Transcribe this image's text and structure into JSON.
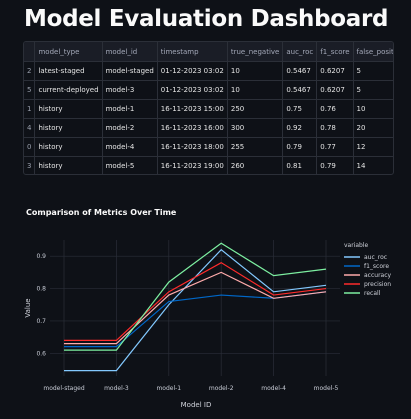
{
  "page": {
    "title": "Model Evaluation Dashboard"
  },
  "table": {
    "columns": [
      "",
      "model_type",
      "model_id",
      "timestamp",
      "true_negative",
      "auc_roc",
      "f1_score",
      "false_positive"
    ],
    "rows": [
      [
        "2",
        "latest-staged",
        "model-staged",
        "01-12-2023 03:02",
        "10",
        "0.5467",
        "0.6207",
        "5"
      ],
      [
        "5",
        "current-deployed",
        "model-3",
        "01-12-2023 03:02",
        "10",
        "0.5467",
        "0.6207",
        "5"
      ],
      [
        "1",
        "history",
        "model-1",
        "16-11-2023 15:00",
        "250",
        "0.75",
        "0.76",
        "10"
      ],
      [
        "4",
        "history",
        "model-2",
        "16-11-2023 16:00",
        "300",
        "0.92",
        "0.78",
        "20"
      ],
      [
        "0",
        "history",
        "model-4",
        "16-11-2023 18:00",
        "255",
        "0.79",
        "0.77",
        "12"
      ],
      [
        "3",
        "history",
        "model-5",
        "16-11-2023 19:00",
        "260",
        "0.81",
        "0.79",
        "14"
      ]
    ]
  },
  "chart_data": {
    "type": "line",
    "title": "Comparison of Metrics Over Time",
    "xlabel": "Model ID",
    "ylabel": "Value",
    "legend_title": "variable",
    "legend_position": "right",
    "categories": [
      "model-staged",
      "model-3",
      "model-1",
      "model-2",
      "model-4",
      "model-5"
    ],
    "yticks": [
      0.6,
      0.7,
      0.8,
      0.9
    ],
    "ylim": [
      0.53,
      0.95
    ],
    "grid": true,
    "series": [
      {
        "name": "auc_roc",
        "color": "#83c9ff",
        "values": [
          0.5467,
          0.5467,
          0.75,
          0.92,
          0.79,
          0.81
        ]
      },
      {
        "name": "f1_score",
        "color": "#0068c9",
        "values": [
          0.6207,
          0.6207,
          0.76,
          0.78,
          0.77,
          0.79
        ]
      },
      {
        "name": "accuracy",
        "color": "#ffabab",
        "values": [
          0.63,
          0.63,
          0.78,
          0.85,
          0.77,
          0.79
        ]
      },
      {
        "name": "precision",
        "color": "#ff2b2b",
        "values": [
          0.64,
          0.64,
          0.79,
          0.88,
          0.78,
          0.8
        ]
      },
      {
        "name": "recall",
        "color": "#7defa1",
        "values": [
          0.61,
          0.61,
          0.82,
          0.94,
          0.84,
          0.86
        ]
      }
    ]
  }
}
